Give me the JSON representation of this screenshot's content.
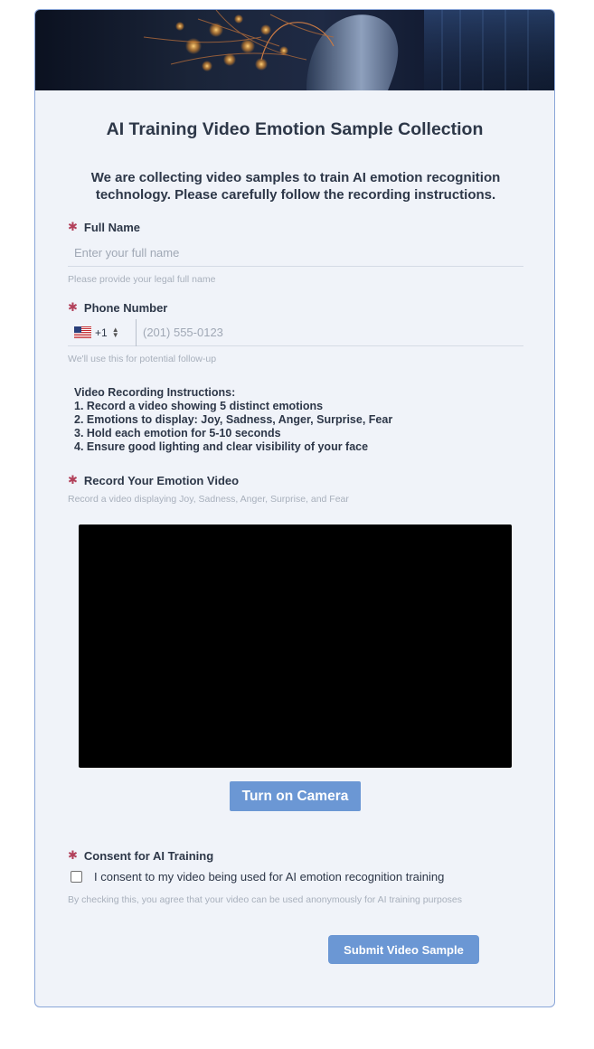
{
  "form": {
    "title": "AI Training Video Emotion Sample Collection",
    "intro": "We are collecting video samples to train AI emotion recognition technology. Please carefully follow the recording instructions.",
    "required_marker": "✱",
    "full_name": {
      "label": "Full Name",
      "placeholder": "Enter your full name",
      "value": "",
      "hint": "Please provide your legal full name"
    },
    "phone": {
      "label": "Phone Number",
      "country_code": "+1",
      "placeholder": "(201) 555-0123",
      "value": "",
      "hint": "We'll use this for potential follow-up"
    },
    "instructions": {
      "heading": "Video Recording Instructions:",
      "steps": [
        "1. Record a video showing 5 distinct emotions",
        "2. Emotions to display: Joy, Sadness, Anger, Surprise, Fear",
        "3. Hold each emotion for 5-10 seconds",
        "4. Ensure good lighting and clear visibility of your face"
      ]
    },
    "video": {
      "label": "Record Your Emotion Video",
      "hint": "Record a video displaying Joy, Sadness, Anger, Surprise, and Fear",
      "camera_button": "Turn on Camera"
    },
    "consent": {
      "label": "Consent for AI Training",
      "checkbox_text": "I consent to my video being used for AI emotion recognition training",
      "checked": false,
      "hint": "By checking this, you agree that your video can be used anonymously for AI training purposes"
    },
    "submit_label": "Submit Video Sample"
  },
  "colors": {
    "accent": "#6b97d4",
    "required": "#b2405a",
    "card_bg": "#f0f3f9",
    "card_border": "#8aa6d8"
  }
}
